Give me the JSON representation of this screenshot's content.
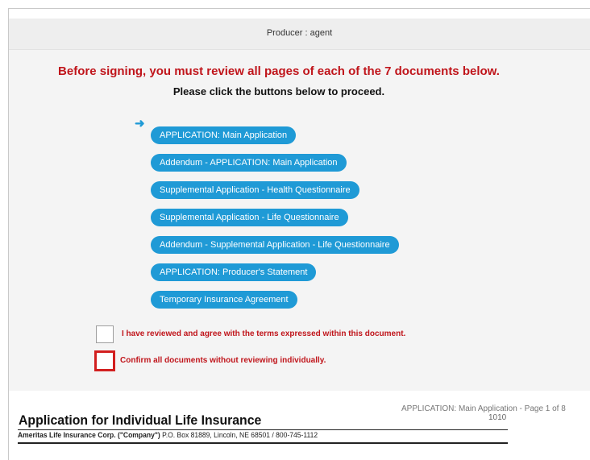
{
  "header": {
    "producer_label": "Producer : agent"
  },
  "review_panel": {
    "warning_text": "Before signing, you must review all pages of each of the 7 documents below.",
    "instruction_text": "Please click the buttons below to proceed.",
    "current_indicator_icon": "right-arrow-icon",
    "documents": [
      {
        "label": "APPLICATION: Main Application"
      },
      {
        "label": "Addendum - APPLICATION: Main Application"
      },
      {
        "label": "Supplemental Application - Health Questionnaire"
      },
      {
        "label": "Supplemental Application - Life Questionnaire"
      },
      {
        "label": "Addendum - Supplemental Application - Life Questionnaire"
      },
      {
        "label": "APPLICATION: Producer's Statement"
      },
      {
        "label": "Temporary Insurance Agreement"
      }
    ],
    "agree_checkbox_label": "I have reviewed and agree with the terms expressed within this document.",
    "confirm_all_checkbox_label": "Confirm all documents without reviewing individually."
  },
  "document_preview": {
    "page_label": "APPLICATION: Main Application - Page 1 of 8",
    "form_number": "1010",
    "title": "Application for Individual Life Insurance",
    "company_name": "Ameritas Life Insurance Corp. (\"Company\")",
    "company_address": "P.O. Box 81889, Lincoln, NE 68501 / 800-745-1112"
  },
  "colors": {
    "accent_blue": "#1f9ad6",
    "warning_red": "#c0151b",
    "checkbox_highlight_red": "#d21f1f",
    "button_text": "#ffffff"
  }
}
